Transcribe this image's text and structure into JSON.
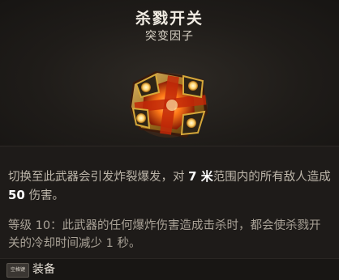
{
  "item": {
    "name": "杀戮开关",
    "type": "突变因子"
  },
  "description": {
    "part1": "切换至此武器会引发炸裂爆发，对 ",
    "distance": "7 米",
    "part2": "范围内的所有敌人造成 ",
    "damage": "50",
    "part3": " 伤害。"
  },
  "level_bonus": "等级 10：此武器的任何爆炸伤害造成击杀时，都会使杀戮开关的冷却时间减少 1 秒。",
  "footer": {
    "key_hint": "空格键",
    "action_label": "装备"
  },
  "icon": "glowing-mutator-cube-icon",
  "colors": {
    "accent_orange": "#ff8a1c",
    "gold": "#c99a2e"
  }
}
